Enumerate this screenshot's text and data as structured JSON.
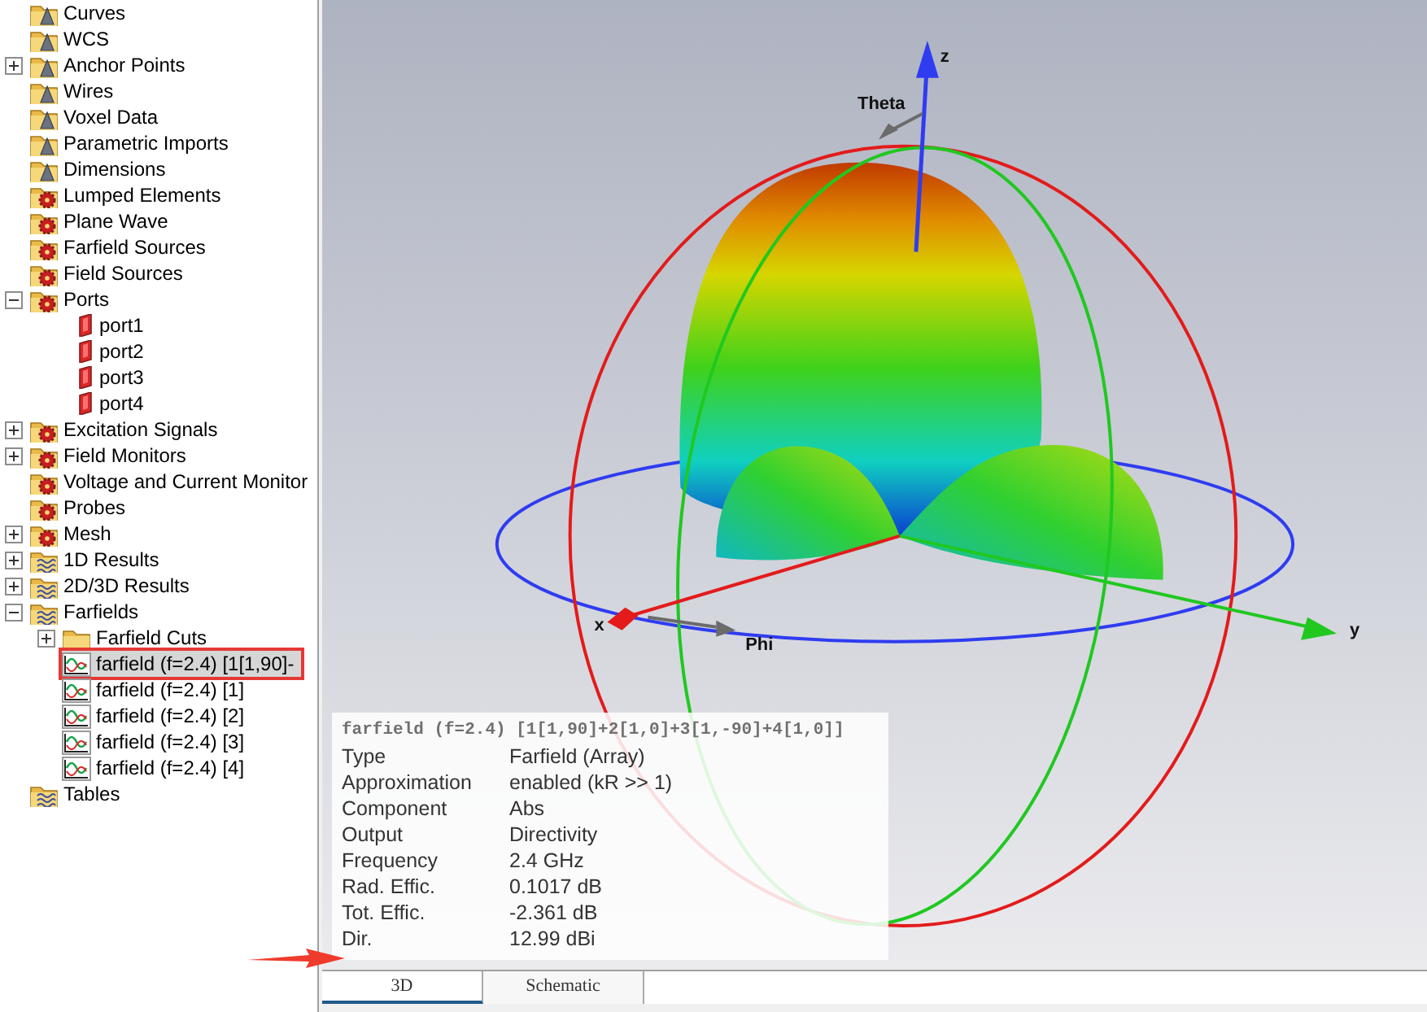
{
  "tree": [
    {
      "label": "Curves",
      "kind": "geometry"
    },
    {
      "label": "WCS",
      "kind": "geometry"
    },
    {
      "label": "Anchor Points",
      "kind": "geometry",
      "expanded": false
    },
    {
      "label": "Wires",
      "kind": "geometry"
    },
    {
      "label": "Voxel Data",
      "kind": "geometry"
    },
    {
      "label": "Parametric Imports",
      "kind": "geometry"
    },
    {
      "label": "Dimensions",
      "kind": "geometry"
    },
    {
      "label": "Lumped Elements",
      "kind": "source"
    },
    {
      "label": "Plane Wave",
      "kind": "source"
    },
    {
      "label": "Farfield Sources",
      "kind": "source"
    },
    {
      "label": "Field Sources",
      "kind": "source"
    },
    {
      "label": "Ports",
      "kind": "source",
      "expanded": true,
      "children": [
        {
          "label": "port1",
          "kind": "port"
        },
        {
          "label": "port2",
          "kind": "port"
        },
        {
          "label": "port3",
          "kind": "port"
        },
        {
          "label": "port4",
          "kind": "port"
        }
      ]
    },
    {
      "label": "Excitation Signals",
      "kind": "source",
      "expanded": false
    },
    {
      "label": "Field Monitors",
      "kind": "source",
      "expanded": false
    },
    {
      "label": "Voltage and Current Monitor",
      "kind": "source"
    },
    {
      "label": "Probes",
      "kind": "source"
    },
    {
      "label": "Mesh",
      "kind": "source",
      "expanded": false
    },
    {
      "label": "1D Results",
      "kind": "result",
      "expanded": false
    },
    {
      "label": "2D/3D Results",
      "kind": "result",
      "expanded": false
    },
    {
      "label": "Farfields",
      "kind": "result",
      "expanded": true,
      "children": [
        {
          "label": "Farfield Cuts",
          "kind": "folder",
          "expanded": false
        },
        {
          "label": "farfield (f=2.4) [1[1,90]-",
          "kind": "farfield",
          "selected": true
        },
        {
          "label": "farfield (f=2.4) [1]",
          "kind": "farfield",
          "selected": false
        },
        {
          "label": "farfield (f=2.4) [2]",
          "kind": "farfield",
          "selected": false
        },
        {
          "label": "farfield (f=2.4) [3]",
          "kind": "farfield",
          "selected": false
        },
        {
          "label": "farfield (f=2.4) [4]",
          "kind": "farfield",
          "selected": false
        }
      ]
    },
    {
      "label": "Tables",
      "kind": "result"
    }
  ],
  "plot": {
    "axis_labels": {
      "z": "z",
      "theta": "Theta",
      "x": "x",
      "phi": "Phi",
      "y": "y"
    }
  },
  "info": {
    "title": "farfield (f=2.4) [1[1,90]+2[1,0]+3[1,-90]+4[1,0]]",
    "rows": [
      {
        "label": "Type",
        "value": "Farfield (Array)"
      },
      {
        "label": "Approximation",
        "value": "enabled (kR >> 1)"
      },
      {
        "label": "Component",
        "value": "Abs"
      },
      {
        "label": "Output",
        "value": "Directivity"
      },
      {
        "label": "Frequency",
        "value": "2.4 GHz"
      },
      {
        "label": "Rad. Effic.",
        "value": "0.1017 dB"
      },
      {
        "label": "Tot. Effic.",
        "value": "-2.361 dB"
      },
      {
        "label": "Dir.",
        "value": "12.99 dBi"
      }
    ]
  },
  "tabs": [
    {
      "label": "3D",
      "selected": true
    },
    {
      "label": "Schematic",
      "selected": false
    }
  ]
}
